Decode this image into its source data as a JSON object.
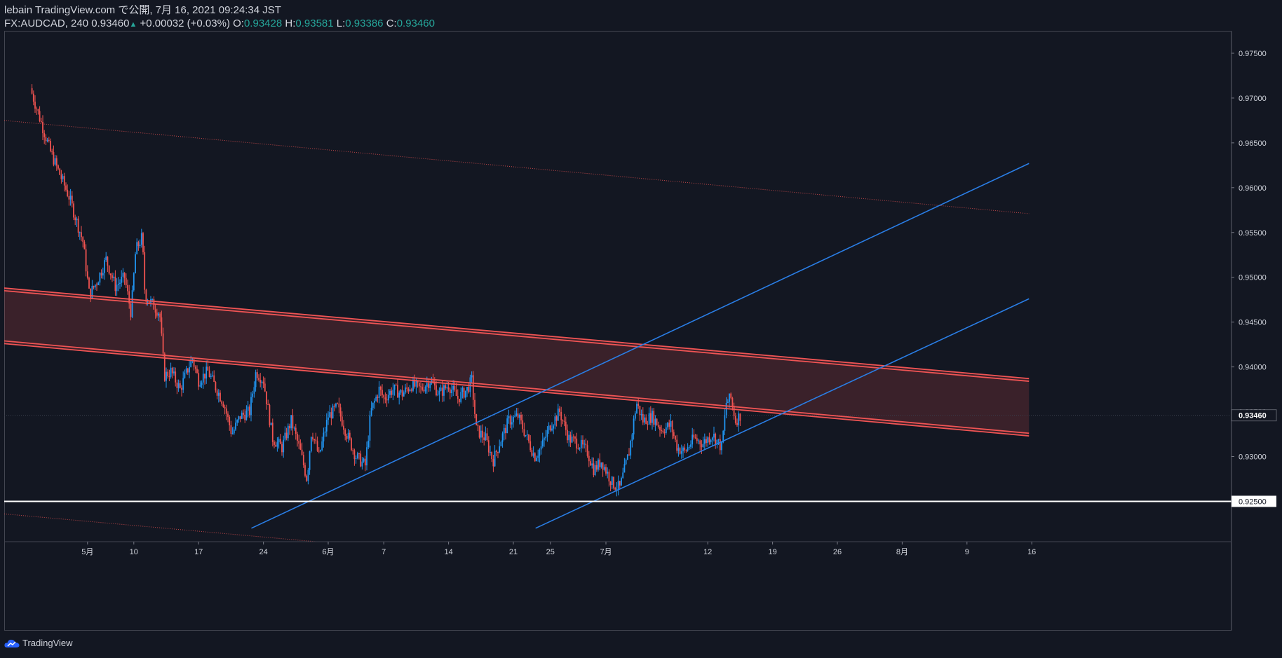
{
  "header": {
    "line1": "lebain TradingView.com で公開, 7月 16, 2021 09:24:34 JST",
    "symbol": "FX:AUDCAD, 240",
    "last": "0.93460",
    "change": "+0.00032 (+0.03%)",
    "o_label": "O:",
    "o_value": "0.93428",
    "h_label": "H:",
    "h_value": "0.93581",
    "l_label": "L:",
    "l_value": "0.93386",
    "c_label": "C:",
    "c_value": "0.93460"
  },
  "footer": {
    "brand": "TradingView"
  },
  "colors": {
    "bg": "#131722",
    "up": "#2196f3",
    "down": "#ef5350",
    "channel": "#f05454",
    "trend": "#2a7ee6",
    "support": "#ffffff"
  },
  "chart_data": {
    "type": "candlestick",
    "symbol": "FX:AUDCAD",
    "interval": "240",
    "ylim": [
      0.9205,
      0.9775
    ],
    "y_ticks": [
      "0.97500",
      "0.97000",
      "0.96500",
      "0.96000",
      "0.95500",
      "0.95000",
      "0.94500",
      "0.94000",
      "0.93500",
      "0.93000",
      "0.92500"
    ],
    "x_ticks": [
      "5月",
      "10",
      "17",
      "24",
      "6月",
      "7",
      "14",
      "21",
      "25",
      "7月",
      "12",
      "19",
      "26",
      "8月",
      "9",
      "16"
    ],
    "x_tick_days": [
      30,
      35,
      42,
      49,
      56,
      62,
      69,
      76,
      80,
      86,
      97,
      104,
      111,
      118,
      125,
      132
    ],
    "last_price_label": "0.93460",
    "support_level": 0.925,
    "support_label": "0.92500",
    "close_anchors": [
      [
        24.0,
        0.9705
      ],
      [
        26.0,
        0.964
      ],
      [
        28.0,
        0.959
      ],
      [
        29.5,
        0.954
      ],
      [
        30.2,
        0.948
      ],
      [
        31.0,
        0.9495
      ],
      [
        32.0,
        0.952
      ],
      [
        33.0,
        0.949
      ],
      [
        34.0,
        0.95
      ],
      [
        34.7,
        0.946
      ],
      [
        35.2,
        0.953
      ],
      [
        35.9,
        0.9545
      ],
      [
        36.2,
        0.948
      ],
      [
        37.0,
        0.947
      ],
      [
        37.8,
        0.946
      ],
      [
        38.3,
        0.939
      ],
      [
        39.0,
        0.9395
      ],
      [
        40.0,
        0.9375
      ],
      [
        41.3,
        0.941
      ],
      [
        42.0,
        0.9385
      ],
      [
        43.0,
        0.9395
      ],
      [
        43.7,
        0.938
      ],
      [
        44.7,
        0.936
      ],
      [
        45.6,
        0.9325
      ],
      [
        46.5,
        0.9345
      ],
      [
        47.5,
        0.935
      ],
      [
        48.2,
        0.9395
      ],
      [
        49.0,
        0.9385
      ],
      [
        50.0,
        0.932
      ],
      [
        51.0,
        0.931
      ],
      [
        52.0,
        0.934
      ],
      [
        53.0,
        0.9305
      ],
      [
        53.7,
        0.9275
      ],
      [
        54.2,
        0.933
      ],
      [
        55.0,
        0.93
      ],
      [
        56.0,
        0.9345
      ],
      [
        57.0,
        0.9355
      ],
      [
        58.0,
        0.9325
      ],
      [
        59.0,
        0.93
      ],
      [
        60.0,
        0.929
      ],
      [
        60.6,
        0.935
      ],
      [
        61.5,
        0.9375
      ],
      [
        62.0,
        0.9365
      ],
      [
        63.0,
        0.9375
      ],
      [
        64.0,
        0.937
      ],
      [
        65.0,
        0.938
      ],
      [
        66.0,
        0.9375
      ],
      [
        67.0,
        0.9385
      ],
      [
        68.0,
        0.937
      ],
      [
        69.0,
        0.938
      ],
      [
        70.0,
        0.9365
      ],
      [
        71.0,
        0.9375
      ],
      [
        71.5,
        0.9385
      ],
      [
        72.0,
        0.933
      ],
      [
        73.0,
        0.932
      ],
      [
        73.8,
        0.9295
      ],
      [
        74.5,
        0.9315
      ],
      [
        75.5,
        0.934
      ],
      [
        76.5,
        0.9345
      ],
      [
        77.5,
        0.932
      ],
      [
        78.3,
        0.93
      ],
      [
        79.0,
        0.931
      ],
      [
        80.0,
        0.9335
      ],
      [
        81.0,
        0.935
      ],
      [
        82.0,
        0.932
      ],
      [
        83.0,
        0.9315
      ],
      [
        84.0,
        0.9305
      ],
      [
        84.7,
        0.9285
      ],
      [
        85.5,
        0.9295
      ],
      [
        86.7,
        0.927
      ],
      [
        87.5,
        0.9265
      ],
      [
        88.5,
        0.9305
      ],
      [
        89.3,
        0.936
      ],
      [
        90.0,
        0.934
      ],
      [
        91.0,
        0.9345
      ],
      [
        92.0,
        0.933
      ],
      [
        93.0,
        0.9335
      ],
      [
        93.7,
        0.931
      ],
      [
        94.5,
        0.9305
      ],
      [
        95.5,
        0.932
      ],
      [
        96.5,
        0.9315
      ],
      [
        97.5,
        0.9325
      ],
      [
        98.5,
        0.931
      ],
      [
        99.0,
        0.936
      ],
      [
        99.5,
        0.9365
      ],
      [
        100.0,
        0.934
      ],
      [
        100.5,
        0.9346
      ]
    ],
    "lines": [
      {
        "name": "resistance-upper-1",
        "from": [
          21,
          0.9488
        ],
        "to": [
          131.7,
          0.9387
        ],
        "style": "solid",
        "color": "#f05454"
      },
      {
        "name": "resistance-upper-2",
        "from": [
          21,
          0.9485
        ],
        "to": [
          131.7,
          0.9384
        ],
        "style": "solid",
        "color": "#f05454"
      },
      {
        "name": "resistance-lower-1",
        "from": [
          21,
          0.9429
        ],
        "to": [
          131.7,
          0.9326
        ],
        "style": "solid",
        "color": "#f05454"
      },
      {
        "name": "resistance-lower-2",
        "from": [
          21,
          0.9426
        ],
        "to": [
          131.7,
          0.9323
        ],
        "style": "solid",
        "color": "#f05454"
      },
      {
        "name": "dotted-channel-top",
        "from": [
          21,
          0.9675
        ],
        "to": [
          131.7,
          0.9571
        ],
        "style": "dotted",
        "color": "#f05454"
      },
      {
        "name": "dotted-channel-bottom",
        "from": [
          21,
          0.9236
        ],
        "to": [
          131.7,
          0.9134
        ],
        "style": "dotted",
        "color": "#f05454"
      },
      {
        "name": "uptrend-upper",
        "from": [
          47.7,
          0.922
        ],
        "to": [
          131.7,
          0.9627
        ],
        "style": "solid",
        "color": "#2a7ee6"
      },
      {
        "name": "uptrend-lower",
        "from": [
          78.4,
          0.922
        ],
        "to": [
          131.7,
          0.9476
        ],
        "style": "solid",
        "color": "#2a7ee6"
      }
    ],
    "zone": {
      "name": "resistance-zone",
      "top": "resistance-upper-1",
      "bottom": "resistance-lower-2",
      "color": "#f05454",
      "opacity": 0.18
    }
  }
}
